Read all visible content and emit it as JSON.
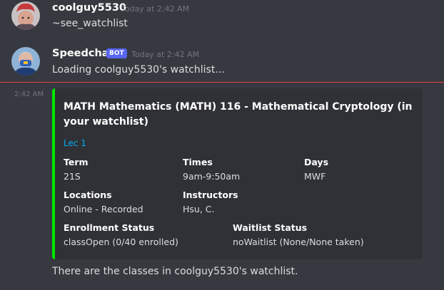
{
  "messages": [
    {
      "author": "coolguy5530",
      "timestamp": "Today at 2:42 AM",
      "content": "~see_watchlist"
    },
    {
      "author": "Speedchat",
      "tag": "BOT",
      "timestamp": "Today at 2:42 AM",
      "content": "Loading coolguy5530's watchlist..."
    }
  ],
  "embed_timestamp": "2:42 AM",
  "embed": {
    "accent_color": "#00e600",
    "title": "MATH Mathematics (MATH) 116 - Mathematical Cryptology (in your watchlist)",
    "link": "Lec 1",
    "fields": {
      "term": {
        "name": "Term",
        "value": "21S"
      },
      "times": {
        "name": "Times",
        "value": "9am-9:50am"
      },
      "days": {
        "name": "Days",
        "value": "MWF"
      },
      "locations": {
        "name": "Locations",
        "value": "Online - Recorded"
      },
      "instructors": {
        "name": "Instructors",
        "value": "Hsu, C."
      },
      "enrollment": {
        "name": "Enrollment Status",
        "value": "classOpen (0/40 enrolled)"
      },
      "waitlist": {
        "name": "Waitlist Status",
        "value": "noWaitlist (None/None taken)"
      }
    }
  },
  "footer_text": "There are the classes in coolguy5530's watchlist."
}
